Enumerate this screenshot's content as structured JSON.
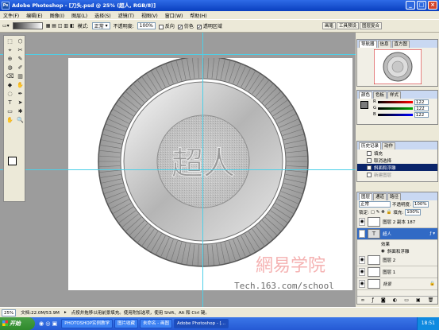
{
  "window": {
    "title": "Adobe Photoshop - [刀头.psd @ 25% (超人, RGB/8)]",
    "app_icon": "Ps"
  },
  "menu": [
    "文件(F)",
    "编辑(E)",
    "图像(I)",
    "图层(L)",
    "选择(S)",
    "滤镜(T)",
    "视图(V)",
    "窗口(W)",
    "帮助(H)"
  ],
  "options": {
    "mode_label": "模式:",
    "mode_value": "正常",
    "opacity_label": "不透明度:",
    "opacity_value": "100%",
    "reverse": "反向",
    "dither": "仿色",
    "transparency": "透明区域"
  },
  "dock_tabs": [
    "画笔",
    "工具预设",
    "图层复合"
  ],
  "canvas": {
    "text": "超人",
    "watermark": "網易学院",
    "url": "Tech.163.com/school"
  },
  "navigator": {
    "tabs": [
      "导航器",
      "信息",
      "直方图"
    ]
  },
  "color_panel": {
    "tabs": [
      "颜色",
      "色板",
      "样式"
    ],
    "r": {
      "label": "R",
      "value": "122"
    },
    "g": {
      "label": "G",
      "value": "122"
    },
    "b": {
      "label": "B",
      "value": "122"
    }
  },
  "history_panel": {
    "tabs": [
      "历史记录",
      "动作"
    ],
    "items": [
      "填充",
      "取消选择",
      "斜面和浮雕",
      "新建图层"
    ]
  },
  "layers_panel": {
    "tabs": [
      "图层",
      "通道",
      "路径"
    ],
    "blend_mode": "正常",
    "opacity_label": "不透明度:",
    "opacity_value": "100%",
    "lock_label": "锁定:",
    "fill_label": "填充:",
    "fill_value": "100%",
    "layers": [
      {
        "name": "图层 2 副本 187"
      },
      {
        "name": "超人",
        "selected": true
      },
      {
        "name": "效果",
        "sub": true
      },
      {
        "name": "斜面和浮雕",
        "sub": true
      },
      {
        "name": "图层 2"
      },
      {
        "name": "图层 1"
      },
      {
        "name": "背景"
      }
    ]
  },
  "status": {
    "zoom": "25%",
    "doc": "文档:22.0M/53.9M",
    "hint": "点按并拖移以用前景填充。使用附加选项，使用 Shift、Alt 和 Ctrl 键。"
  },
  "taskbar": {
    "start": "开始",
    "tasks": [
      "PHOTOSHOP实例教学",
      "图片收藏",
      "未命名 - 画图",
      "Adobe Photoshop - [..."
    ],
    "time": "18:51"
  }
}
